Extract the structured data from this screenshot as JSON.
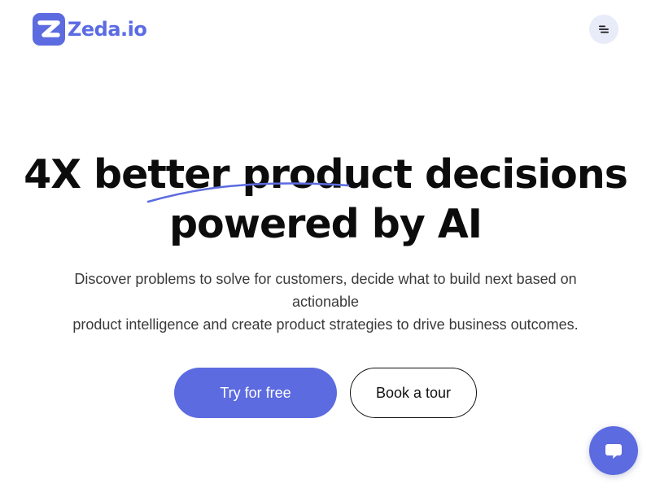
{
  "header": {
    "logo_text": "Zeda.io",
    "logo_icon": "zeda-z-logo-icon",
    "menu_icon": "hamburger-menu-icon"
  },
  "hero": {
    "title_line1": "4X better product decisions",
    "title_line2": "powered by AI",
    "subtitle_line1": "Discover problems to solve for customers, decide what to build next based on",
    "subtitle_line2": "actionable",
    "subtitle_line3": "product intelligence and create product strategies to drive business outcomes."
  },
  "cta": {
    "primary_label": "Try for free",
    "secondary_label": "Book a tour"
  },
  "chat": {
    "icon": "chat-bubble-icon"
  },
  "colors": {
    "brand": "#5C6BE0",
    "menu_bg": "#E8EBF8",
    "text_dark": "#0c0c0c",
    "text_body": "#3a3a3a"
  }
}
